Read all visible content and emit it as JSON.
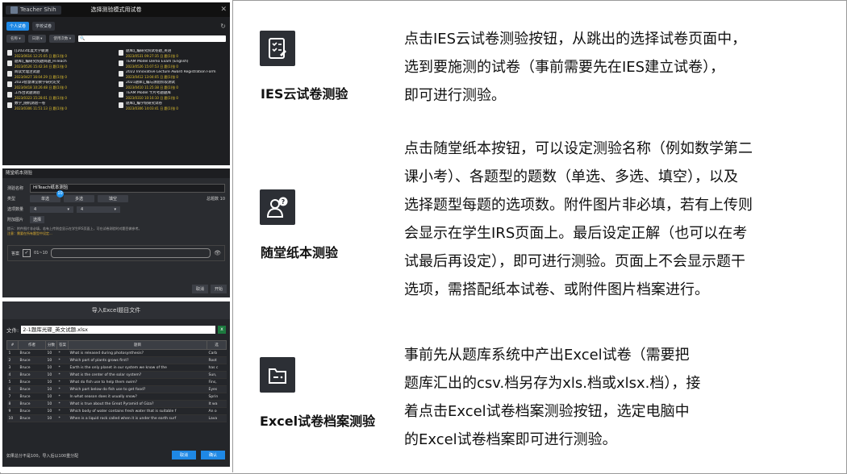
{
  "shot1": {
    "user": "Teacher Shih",
    "title": "选择测验模式用试卷",
    "close": "✕",
    "tabs": [
      "个人试卷",
      "学校试卷"
    ],
    "refresh": "↻",
    "filters": [
      "名称 ▾",
      "日期 ▾",
      "使用次数 ▾"
    ],
    "search_icon": "🔍",
    "exams": [
      {
        "title": "[[2023年度大学联测",
        "date": "2023/0616 12:25:05 日 题(1)张 0"
      },
      {
        "title": "题库汇编研究院试卷题_英语",
        "date": "2023/0531 09:27:35 日 题(1)张 0"
      },
      {
        "title": "题库汇编研究院题目题_HiTeach",
        "date": "2023/0526 15:42:34 日 题(1)张 0"
      },
      {
        "title": "TEAM Model Demo Exam (English)",
        "date": "2023/0526 15:07:53 日 题(1)张 0"
      },
      {
        "title": "阅读文理注试题",
        "date": "2023/0427 16:04:29 日 题(1)张 0"
      },
      {
        "title": "2022 Innovative Lecture Award Registration Form",
        "date": "2023/0412 13:04:05 日 题(1)张 0"
      },
      {
        "title": "2023智慧课堂教学研究论文",
        "date": "2023/0418 10:26:48 日 题(1)张 0"
      },
      {
        "title": "2021题库汇编与测验阶段测试",
        "date": "2023/0410 11:25:38 日 题(1)张 0"
      },
      {
        "title": "工作台试题测验",
        "date": "2023/0323 15:28:01 日 题(1)张 0"
      },
      {
        "title": "TEAM Model 卡片考题题库",
        "date": "2023/0310 10:16:10 日 题(1)张 0"
      },
      {
        "title": "数学_随机测验一卷",
        "date": "2023/0306 11:51:13 日 题(1)张 0"
      },
      {
        "title": "题库汇编学院研究试卷",
        "date": "2023/0306 14:03:41 日 题(1)张 0"
      }
    ]
  },
  "shot2": {
    "title": "随堂纸本测验",
    "name_label": "测验名称",
    "name_value": "HiTeach纸本测验",
    "type_label": "类型",
    "types": [
      "单选",
      "多选",
      "填空"
    ],
    "badge": "10",
    "total": "总题数 10",
    "options_label": "选项数量",
    "opt1": "4",
    "opt2": "4",
    "attach_label": "附加图片",
    "attach_btn": "选择",
    "note1": "提示：附件图片非必填，若有上传则会显示在学生IRS页面上，可在试卷测验时对题目做参考。",
    "note2": "注意：需要在所有题型中设定...",
    "answer_label": "答案",
    "answer_check": "✓",
    "answer_range": "01~10",
    "eye": "👁",
    "cancel": "取消",
    "start": "开始"
  },
  "shot3": {
    "title": "导入Excel题目文件",
    "file_label": "文件:",
    "file_value": "2-1题库光碟_英文试题.xlsx",
    "xls": "x",
    "headers": [
      "#",
      "作者",
      "分数",
      "答案",
      "题目",
      "选"
    ],
    "rows": [
      [
        "1",
        "Bruce",
        "10",
        "*",
        "What is released during photosynthesis?",
        "Carb"
      ],
      [
        "2",
        "Bruce",
        "10",
        "*",
        "Which part of plants grows first?",
        "Root"
      ],
      [
        "3",
        "Bruce",
        "10",
        "*",
        "Earth is the only planet in our system we know of the",
        "has c"
      ],
      [
        "4",
        "Bruce",
        "10",
        "*",
        "What is the center of the solar system?",
        "Sun,"
      ],
      [
        "5",
        "Bruce",
        "10",
        "*",
        "What do fish use to help them swim?",
        "Fins,"
      ],
      [
        "6",
        "Bruce",
        "10",
        "*",
        "Which part below do fish use to get food?",
        "Eyes"
      ],
      [
        "7",
        "Bruce",
        "10",
        "*",
        "In what season does it usually snow?",
        "Sprin"
      ],
      [
        "8",
        "Bruce",
        "10",
        "*",
        "What is true about the Great Pyramid of Giza?",
        "It wa"
      ],
      [
        "9",
        "Bruce",
        "10",
        "*",
        "Which body of water contains fresh water that is suitable f",
        "An o"
      ],
      [
        "10",
        "Bruce",
        "10",
        "*",
        "When is a liquid rock called when it is under the earth surf",
        "Lava"
      ]
    ],
    "footer": "如果总分不是100，导入后以100重分配",
    "cancel": "取消",
    "confirm": "确认"
  },
  "features": [
    {
      "label": "IES云试卷测验",
      "icon": "checklist-icon",
      "lines": [
        "点击IES云试卷测验按钮，从跳出的选择试卷页面中，",
        "选到要施测的试卷（事前需要先在IES建立试卷），",
        "即可进行测验。"
      ]
    },
    {
      "label": "随堂纸本测验",
      "icon": "person-question-icon",
      "lines": [
        "点击随堂纸本按钮，可以设定测验名称（例如数学第二",
        "课小考）、各题型的题数（单选、多选、填空），以及",
        "选择题型每题的选项数。附件图片非必填，若有上传则",
        "会显示在学生IRS页面上。最后设定正解（也可以在考",
        "试最后再设定），即可进行测验。页面上不会显示题干",
        "选项，需搭配纸本试卷、或附件图片档案进行。"
      ]
    },
    {
      "label": "Excel试卷档案测验",
      "icon": "folder-icon",
      "lines": [
        "事前先从题库系统中产出Excel试卷（需要把",
        "题库汇出的csv.档另存为xls.档或xlsx.档），接",
        "着点击Excel试卷档案测验按钮，选定电脑中",
        "的Excel试卷档案即可进行测验。"
      ]
    }
  ]
}
